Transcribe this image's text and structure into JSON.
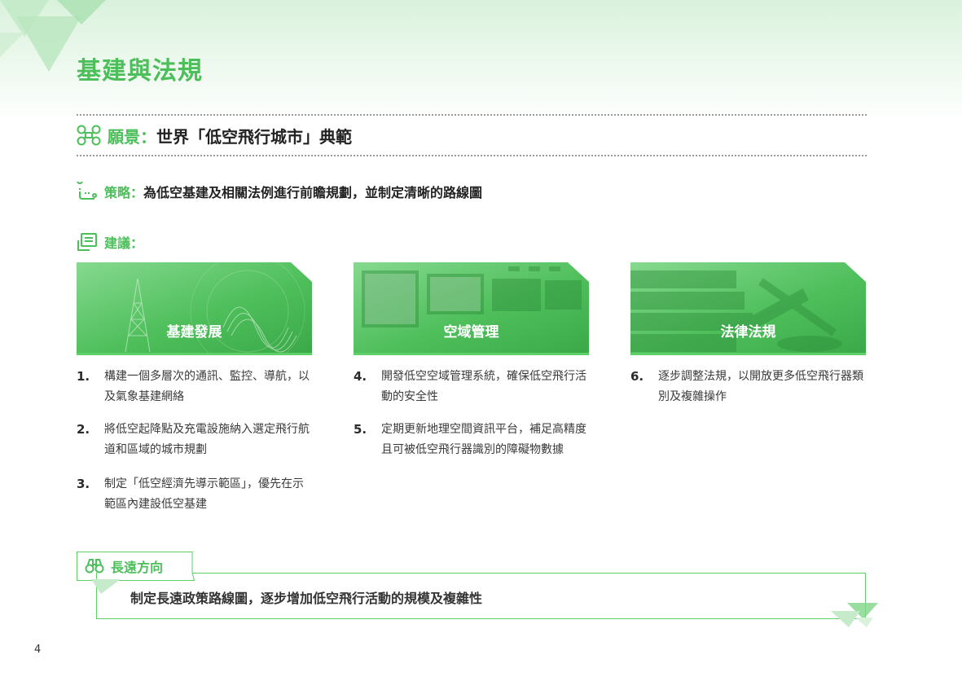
{
  "title": "基建與法規",
  "vision": {
    "label": "願景：",
    "text": "世界「低空飛行城市」典範",
    "icon": "drone-icon"
  },
  "strategy": {
    "label": "策略：",
    "text": "為低空基建及相關法例進行前瞻規劃，並制定清晰的路線圖",
    "icon": "route-icon"
  },
  "advice": {
    "label": "建議：",
    "icon": "document-list-icon"
  },
  "cards": [
    {
      "title": "基建發展",
      "image": "telecom-tower-image"
    },
    {
      "title": "空域管理",
      "image": "control-room-image"
    },
    {
      "title": "法律法規",
      "image": "gavel-books-image"
    }
  ],
  "items": [
    {
      "num": "1.",
      "text": "構建一個多層次的通訊、監控、導航，以及氣象基建網絡"
    },
    {
      "num": "2.",
      "text": "將低空起降點及充電設施納入選定飛行航道和區域的城市規劃"
    },
    {
      "num": "3.",
      "text": "制定「低空經濟先導示範區」，優先在示範區內建設低空基建"
    },
    {
      "num": "4.",
      "text": "開發低空空域管理系統，確保低空飛行活動的安全性"
    },
    {
      "num": "5.",
      "text": "定期更新地理空間資訊平台，補足高精度且可被低空飛行器識別的障礙物數據"
    },
    {
      "num": "6.",
      "text": "逐步調整法規，以開放更多低空飛行器類別及複雜操作"
    }
  ],
  "long_term": {
    "label": "長遠方向",
    "text": "制定長遠政策路線圖，逐步增加低空飛行活動的規模及複雜性",
    "icon": "binoculars-icon"
  },
  "page_number": "4",
  "colors": {
    "accent": "#4cbf5a",
    "accent_light": "#d9f2dc",
    "text": "#2b2b2b"
  }
}
